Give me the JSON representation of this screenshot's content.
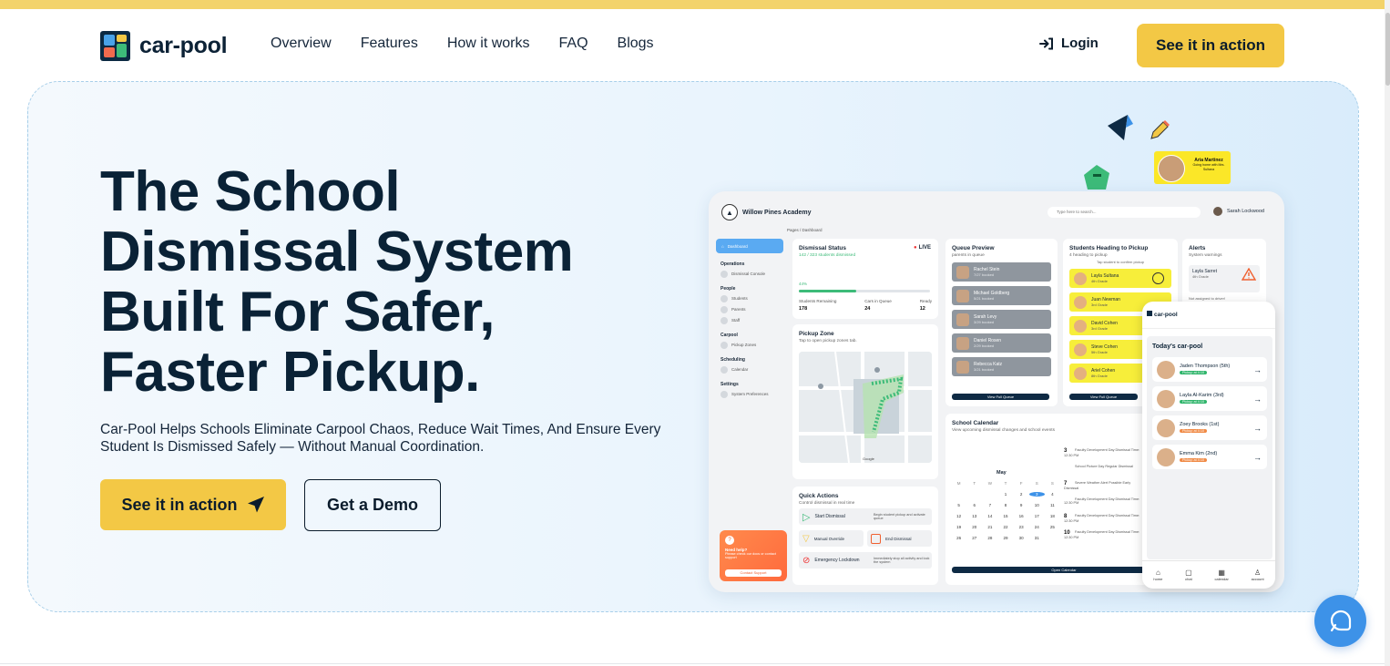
{
  "brand": {
    "name": "car-pool"
  },
  "nav": {
    "links": [
      "Overview",
      "Features",
      "How it works",
      "FAQ",
      "Blogs"
    ],
    "login": "Login",
    "cta": "See it in action"
  },
  "hero": {
    "headline": "The School Dismissal System Built For Safer, Faster Pickup.",
    "subtext": "Car-Pool Helps Schools Eliminate Carpool Chaos, Reduce Wait Times, And Ensure Every Student Is Dismissed Safely — Without Manual Coordination.",
    "primary_button": "See it in action",
    "secondary_button": "Get a Demo"
  },
  "mockup": {
    "school": "Willow Pines Academy",
    "search_placeholder": "Type here to search...",
    "user": "Sarah Lockwood",
    "breadcrumb": "Pages / Dashboard",
    "sidebar": {
      "active": "Dashboard",
      "sections": [
        {
          "title": "Operations",
          "items": [
            "Dismissal Console"
          ]
        },
        {
          "title": "People",
          "items": [
            "Students",
            "Parents",
            "Staff"
          ]
        },
        {
          "title": "Carpool",
          "items": [
            "Pickup Zones"
          ]
        },
        {
          "title": "Scheduling",
          "items": [
            "Calendar"
          ]
        },
        {
          "title": "Settings",
          "items": [
            "System Preferences"
          ]
        }
      ],
      "help_title": "Need help?",
      "help_text": "Please check our docs or contact support",
      "help_button": "Contact Support"
    },
    "dismissal": {
      "title": "Dismissal Status",
      "live": "LIVE",
      "subtitle": "142 / 323 students dismissed",
      "percent_label": "44%",
      "progress": 0.44,
      "stats": [
        {
          "label": "Students Remaining",
          "value": "178"
        },
        {
          "label": "Cars in Queue",
          "value": "24"
        },
        {
          "label": "Ready",
          "value": "12"
        }
      ]
    },
    "queue": {
      "title": "Queue Preview",
      "subtitle": "parents in queue",
      "rows": [
        {
          "name": "Rachel Stein",
          "sub": "7/27 booked"
        },
        {
          "name": "Michael Goldberg",
          "sub": "5/21 booked"
        },
        {
          "name": "Sarah Levy",
          "sub": "3/29 booked"
        },
        {
          "name": "Daniel Rosen",
          "sub": "2/29 booked"
        },
        {
          "name": "Rebecca Katz",
          "sub": "3/21 booked"
        }
      ],
      "button": "View Full Queue"
    },
    "heading": {
      "title": "Students Heading to Pickup",
      "subtitle": "4 heading to pickup",
      "hint": "Tap student to confirm pickup",
      "rows": [
        {
          "name": "Layla Sultana",
          "grade": "4th Grade"
        },
        {
          "name": "Juan Newman",
          "grade": "3rd Grade"
        },
        {
          "name": "David Cohen",
          "grade": "3rd Grade"
        },
        {
          "name": "Steve Cohen",
          "grade": "5th Grade"
        },
        {
          "name": "Ariel Cohen",
          "grade": "8th Grade"
        }
      ],
      "button": "View Full Queue"
    },
    "alerts": {
      "title": "Alerts",
      "subtitle": "System warnings",
      "name": "Layla Sarret",
      "grade": "4th Grade",
      "note": "Not assigned to driver!"
    },
    "pickup": {
      "title": "Pickup Zone",
      "subtitle": "Tap to open pickup zones tab.",
      "map_labels": [
        "Google"
      ]
    },
    "quick_actions": {
      "title": "Quick Actions",
      "subtitle": "Control dismissal in real time",
      "rows": [
        {
          "label": "Start Dismissal",
          "desc": "Begin student pickup and activate queue"
        },
        {
          "label": "Manual Override",
          "desc": ""
        },
        {
          "label": "End Dismissal",
          "desc": ""
        },
        {
          "label": "Emergency Lockdown",
          "desc": "Immediately stop all activity and lock the system"
        }
      ]
    },
    "calendar": {
      "title": "School Calendar",
      "subtitle": "View upcoming dismissal changes and school events",
      "month": "May",
      "weekdays": [
        "M",
        "T",
        "W",
        "T",
        "F",
        "S",
        "S"
      ],
      "days": [
        "",
        "",
        "",
        "1",
        "2",
        "3",
        "4",
        "5",
        "6",
        "7",
        "8",
        "9",
        "10",
        "11",
        "12",
        "13",
        "14",
        "15",
        "16",
        "17",
        "18",
        "19",
        "20",
        "21",
        "22",
        "23",
        "24",
        "25",
        "26",
        "27",
        "28",
        "29",
        "30",
        "31",
        ""
      ],
      "events": [
        {
          "day": "3",
          "text": "Faculty Development Day Dismissal Time: 12:30 PM"
        },
        {
          "day": "",
          "text": "School Picture Day Regular Dismissal"
        },
        {
          "day": "7",
          "text": "Severe Weather Alert Possible Early Dismissal"
        },
        {
          "day": "",
          "text": "Faculty Development Day Dismissal Time: 12:30 PM"
        },
        {
          "day": "8",
          "text": "Faculty Development Day Dismissal Time: 12:30 PM"
        },
        {
          "day": "10",
          "text": "Faculty Development Day Dismissal Time: 12:30 PM"
        }
      ],
      "button": "Open Calendar"
    }
  },
  "phone": {
    "brand": "car-pool",
    "title": "Today's car-pool",
    "kids": [
      {
        "name": "Jaden Thompson (5th)",
        "tag": "Pickup at 4:10",
        "color": "#2fb56b"
      },
      {
        "name": "Layla Al-Karim (3rd)",
        "tag": "Pickup at 4:10",
        "color": "#2fb56b"
      },
      {
        "name": "Zoey Brooks (1st)",
        "tag": "Pickup at 4:10",
        "color": "#f08a45"
      },
      {
        "name": "Emma Kim (2nd)",
        "tag": "Pickup at 4:10",
        "color": "#f08a45"
      }
    ],
    "tabs": [
      "home",
      "chat",
      "calendar",
      "account"
    ]
  },
  "badge": {
    "name": "Aria Martinez",
    "text": "Going home with Mrs. Sultana"
  },
  "colors": {
    "accent": "#f3c845",
    "navy": "#0a2236",
    "chat": "#3d92e8"
  },
  "icons": {
    "login": "login-arrow-icon",
    "primary_button": "send-arrow-icon",
    "chat": "chat-support-icon"
  }
}
